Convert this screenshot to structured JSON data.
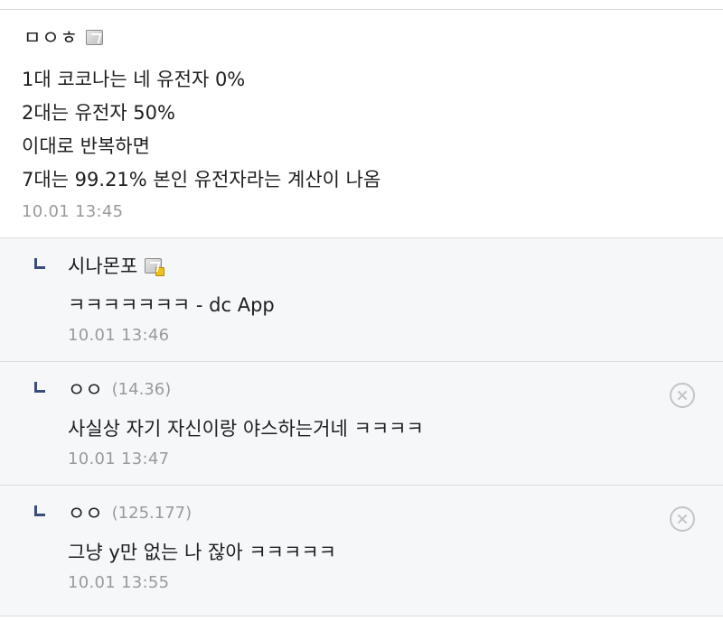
{
  "comment": {
    "author": "ㅁㅇㅎ",
    "author_badge_icon": "gallog-icon",
    "lines": [
      "1대 코코나는 네 유전자 0%",
      "2대는 유전자 50%",
      "이대로 반복하면",
      "7대는 99.21% 본인 유전자라는 계산이 나옴"
    ],
    "time": "10.01 13:45"
  },
  "replies": [
    {
      "author": "시나몬포",
      "author_badge_icon": "gallog-icon-gold",
      "ip": "",
      "text": "ㅋㅋㅋㅋㅋㅋㅋ - dc App",
      "time": "10.01 13:46",
      "deletable": false
    },
    {
      "author": "ㅇㅇ",
      "ip": "(14.36)",
      "text": "사실상 자기 자신이랑 야스하는거네 ㅋㅋㅋㅋ",
      "time": "10.01 13:47",
      "deletable": true
    },
    {
      "author": "ㅇㅇ",
      "ip": "(125.177)",
      "text": "그냥 y만 없는 나 잖아 ㅋㅋㅋㅋㅋ",
      "time": "10.01 13:55",
      "deletable": true
    }
  ],
  "colors": {
    "reply_bg": "#f6f7f9",
    "reply_arrow": "#3b4d7a",
    "meta_gray": "#9a9a9a"
  }
}
